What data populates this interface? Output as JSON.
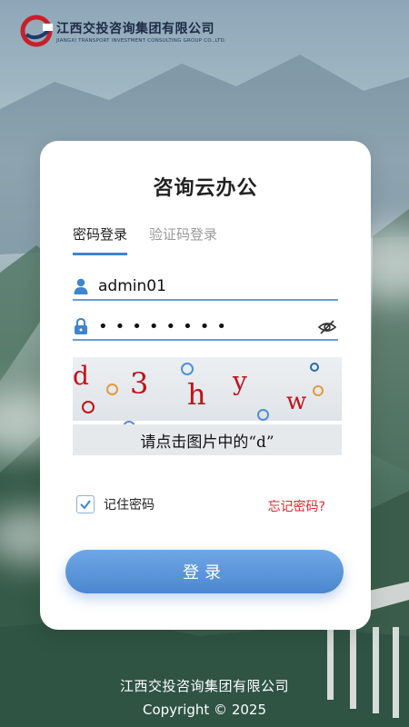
{
  "header": {
    "company_cn": "江西交投咨询集团有限公司",
    "company_en": "JIANGXI TRANSPORT INVESTMENT CONSULTING GROUP CO.,LTD."
  },
  "card": {
    "title": "咨询云办公",
    "tabs": [
      {
        "label": "密码登录",
        "active": true
      },
      {
        "label": "验证码登录",
        "active": false
      }
    ],
    "username": {
      "value": "admin01",
      "icon": "user-icon"
    },
    "password": {
      "value": "••••••••",
      "icon": "lock-icon",
      "toggle_icon": "eye-off-icon"
    },
    "captcha": {
      "chars": [
        "d",
        "3",
        "h",
        "y",
        "w"
      ],
      "hint": "请点击图片中的“d”"
    },
    "remember": {
      "label": "记住密码",
      "checked": true
    },
    "forgot_label": "忘记密码?",
    "login_label": "登录"
  },
  "footer": {
    "company": "江西交投咨询集团有限公司",
    "copyright": "Copyright © 2025"
  },
  "colors": {
    "accent": "#4c86cf",
    "tab_underline": "#3e84cf",
    "forgot": "#d9282f",
    "captcha_text": "#c0121a"
  }
}
